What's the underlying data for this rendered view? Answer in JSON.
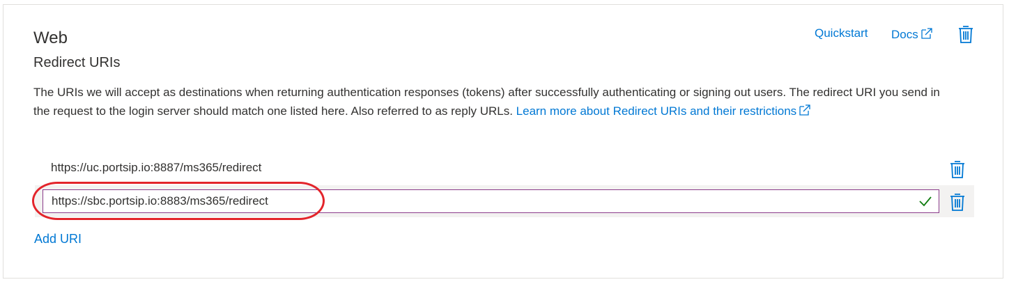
{
  "section": {
    "title": "Web",
    "subtitle": "Redirect URIs",
    "description": "The URIs we will accept as destinations when returning authentication responses (tokens) after successfully authenticating or signing out users. The redirect URI you send in the request to the login server should match one listed here. Also referred to as reply URLs. ",
    "learn_more_label": "Learn more about Redirect URIs and their restrictions"
  },
  "header_links": {
    "quickstart": "Quickstart",
    "docs": "Docs"
  },
  "redirect_uris": [
    {
      "value": "https://uc.portsip.io:8887/ms365/redirect"
    },
    {
      "value": "https://sbc.portsip.io:8883/ms365/redirect",
      "valid": true
    }
  ],
  "add_uri_label": "Add URI",
  "colors": {
    "link": "#0078d4",
    "highlight": "#e3242b",
    "valid_check": "#107c10"
  },
  "icons": {
    "delete": "trash-icon",
    "external": "external-link-icon",
    "valid": "checkmark-icon"
  }
}
